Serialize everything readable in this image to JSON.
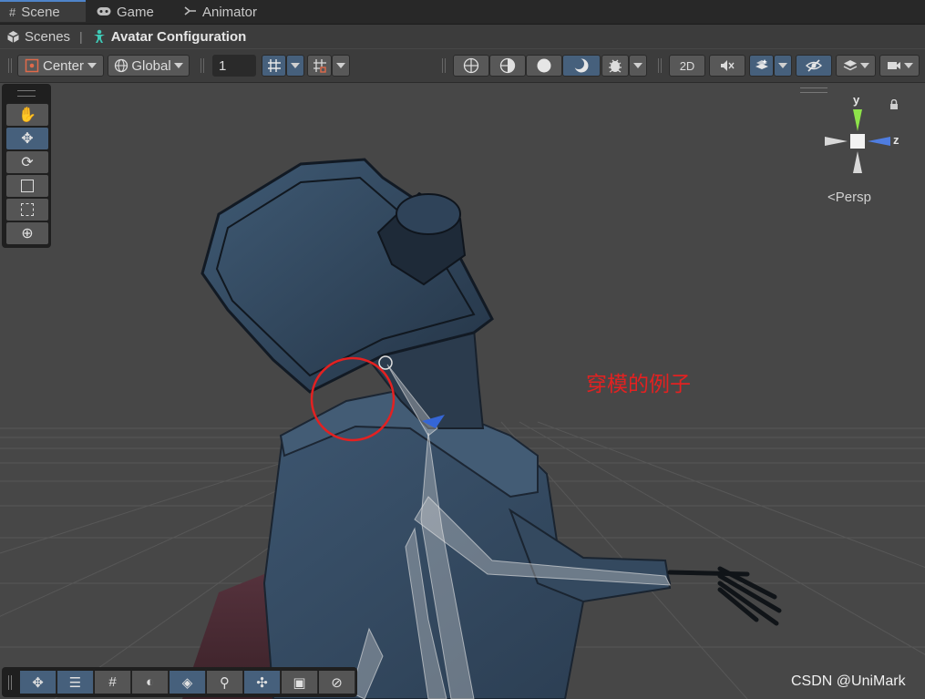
{
  "tabs": [
    {
      "label": "Scene",
      "icon": "hash-icon",
      "active": true
    },
    {
      "label": "Game",
      "icon": "gamepad-icon",
      "active": false
    },
    {
      "label": "Animator",
      "icon": "animator-icon",
      "active": false
    }
  ],
  "breadcrumb": {
    "root": "Scenes",
    "separator": "|",
    "current": "Avatar Configuration"
  },
  "toolbar": {
    "pivot_mode": "Center",
    "pivot_rotation": "Global",
    "grid_size_value": "1",
    "mode_2d": "2D"
  },
  "gizmo": {
    "axis_y": "y",
    "axis_z": "z",
    "projection": "Persp",
    "colors": {
      "y": "#8ee34a",
      "z": "#4f7de0",
      "x": "#d8d8d8"
    }
  },
  "tools": [
    {
      "name": "hand-tool",
      "icon": "hand-icon",
      "active": false
    },
    {
      "name": "move-tool",
      "icon": "move-icon",
      "active": true
    },
    {
      "name": "rotate-tool",
      "icon": "rotate-icon",
      "active": false
    },
    {
      "name": "scale-tool",
      "icon": "scale-icon",
      "active": false
    },
    {
      "name": "rect-tool",
      "icon": "rect-icon",
      "active": false
    },
    {
      "name": "transform-tool",
      "icon": "transform-icon",
      "active": false
    }
  ],
  "bottom_tools": [
    {
      "name": "move-handle",
      "icon": "move-icon",
      "active": true
    },
    {
      "name": "sliders",
      "icon": "sliders-icon",
      "active": true
    },
    {
      "name": "grid-snap",
      "icon": "grid-icon",
      "active": false
    },
    {
      "name": "shading",
      "icon": "moon-icon",
      "active": false
    },
    {
      "name": "layers",
      "icon": "layers-icon",
      "active": true
    },
    {
      "name": "search",
      "icon": "search-icon",
      "active": false
    },
    {
      "name": "pivot",
      "icon": "pivot-icon",
      "active": true
    },
    {
      "name": "camera-visibility",
      "icon": "camera-eye-icon",
      "active": false
    },
    {
      "name": "compass",
      "icon": "compass-icon",
      "active": false
    }
  ],
  "annotation": "穿模的例子",
  "watermark": "CSDN @UniMark",
  "accent_color": "#46607c",
  "annotation_color": "#e32121"
}
